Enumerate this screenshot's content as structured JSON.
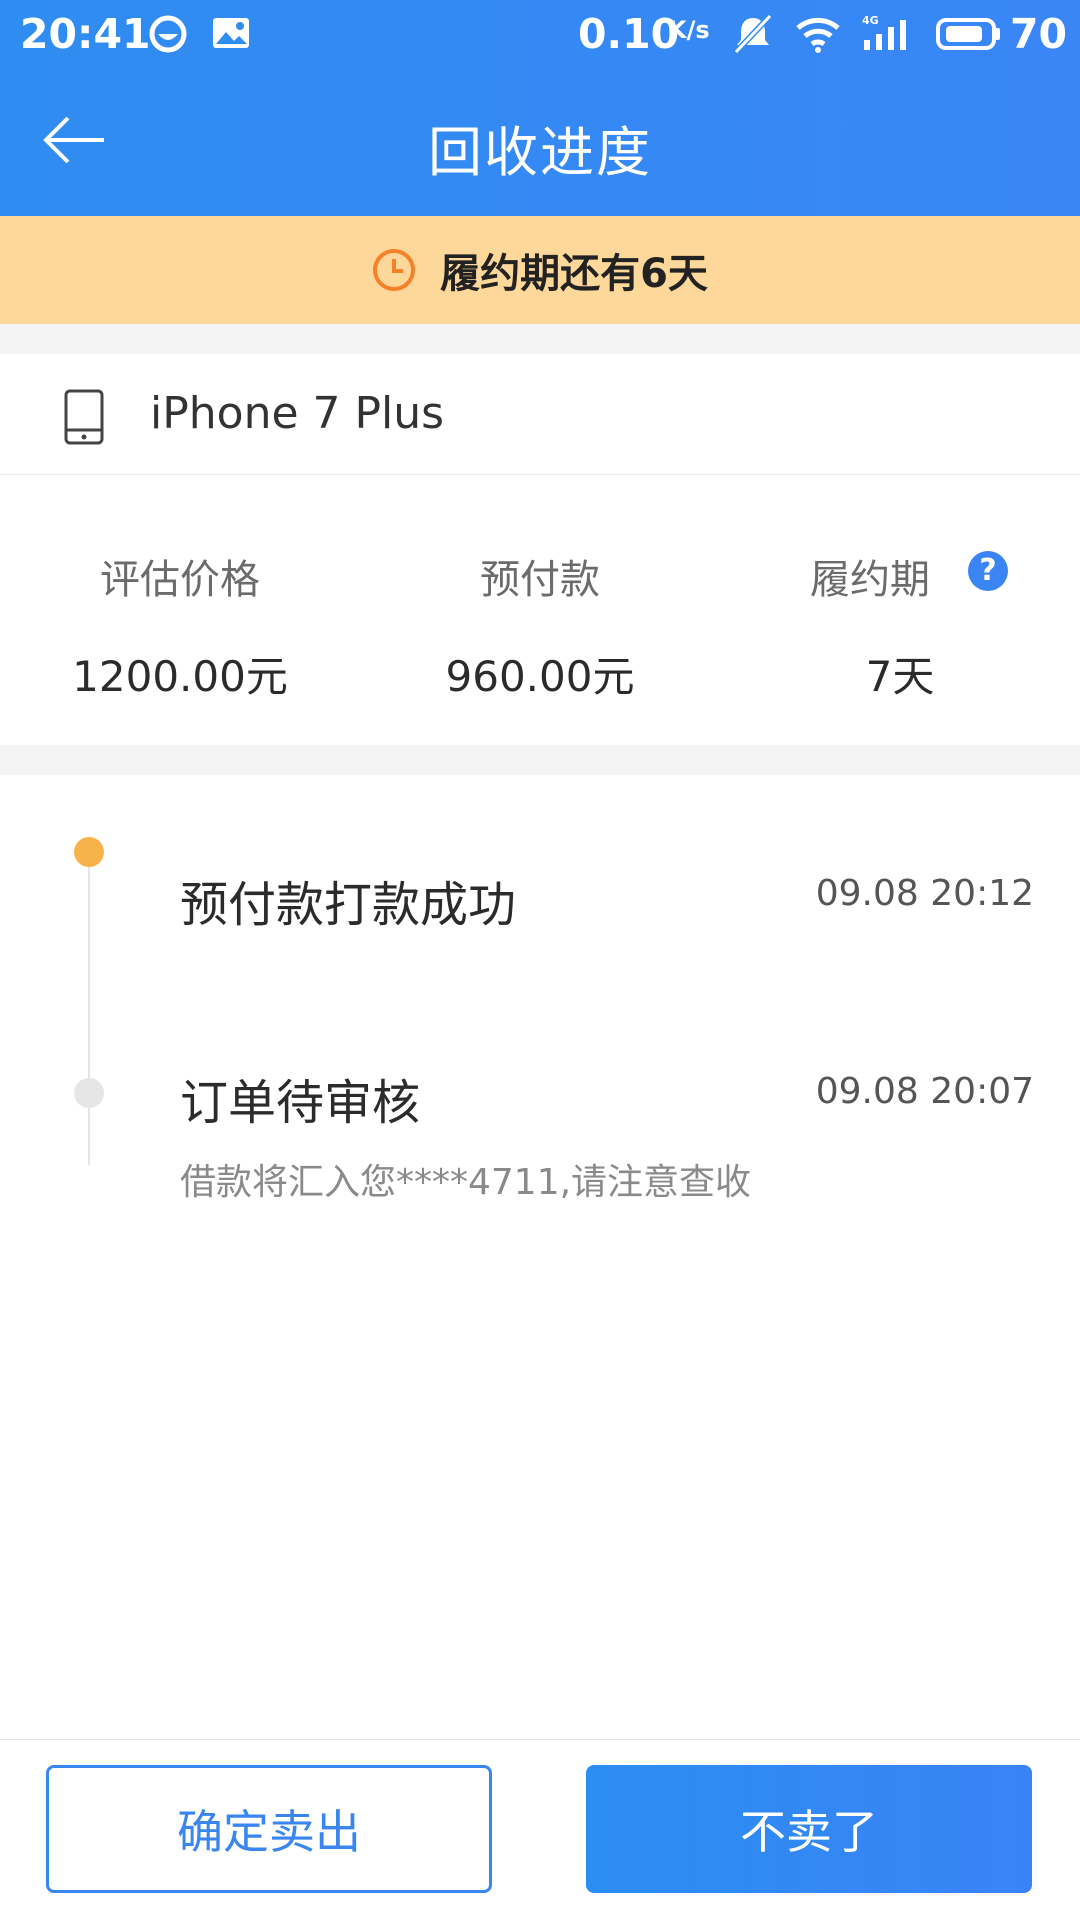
{
  "status_bar": {
    "time": "20:41",
    "speed": "0.10",
    "speed_unit": "K/s",
    "network": "4G",
    "battery": "70"
  },
  "appbar": {
    "title": "回收进度",
    "back_icon": "arrow-left-icon"
  },
  "banner": {
    "text": "履约期还有6天",
    "icon": "clock-icon",
    "background": "#fdd89a"
  },
  "device": {
    "name": "iPhone 7 Plus",
    "icon": "phone-icon"
  },
  "info": {
    "columns": [
      {
        "label": "评估价格",
        "value": "1200.00元"
      },
      {
        "label": "预付款",
        "value": "960.00元"
      },
      {
        "label": "履约期",
        "value": "7天"
      }
    ]
  },
  "timeline": {
    "events": [
      {
        "title": "预付款打款成功",
        "time": "09.08 20:12",
        "desc": ""
      },
      {
        "title": "订单待审核",
        "time": "09.08 20:07",
        "desc": "借款将汇入您****4711,请注意查收"
      }
    ]
  },
  "actions": {
    "confirm": "确定卖出",
    "cancel": "不卖了"
  },
  "colors": {
    "primary": "#3a86f0",
    "active_dot": "#f8b24a",
    "clock_orange": "#f5822a"
  }
}
